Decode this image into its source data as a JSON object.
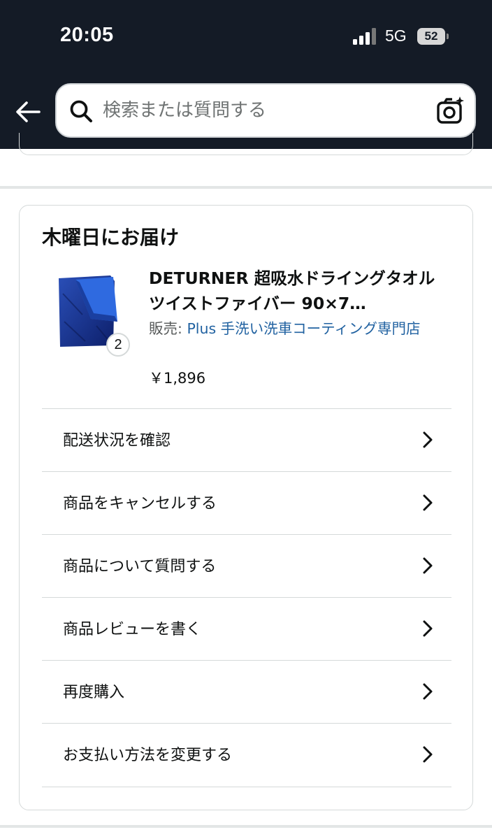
{
  "status_bar": {
    "time": "20:05",
    "network": "5G",
    "battery": "52"
  },
  "header": {
    "search_placeholder": "検索または質問する",
    "back_icon": "back-arrow-icon",
    "camera_icon": "camera-scan-icon"
  },
  "delivery": {
    "title": "木曜日にお届け",
    "product": {
      "title": "DETURNER 超吸水ドライングタオル ツイストファイバー 90×7…",
      "seller_prefix": "販売: ",
      "seller_name": "Plus 手洗い洗車コーティング専門店",
      "price": "￥1,896",
      "quantity": "2",
      "thumbnail": "blue-towel-image"
    },
    "actions": [
      {
        "label": "配送状況を確認"
      },
      {
        "label": "商品をキャンセルする"
      },
      {
        "label": "商品について質問する"
      },
      {
        "label": "商品レビューを書く"
      },
      {
        "label": "再度購入"
      },
      {
        "label": "お支払い方法を変更する"
      }
    ]
  },
  "colors": {
    "header_bg": "#141b26",
    "link": "#2162a1",
    "border": "#d5d9d9",
    "text": "#0f1111"
  }
}
